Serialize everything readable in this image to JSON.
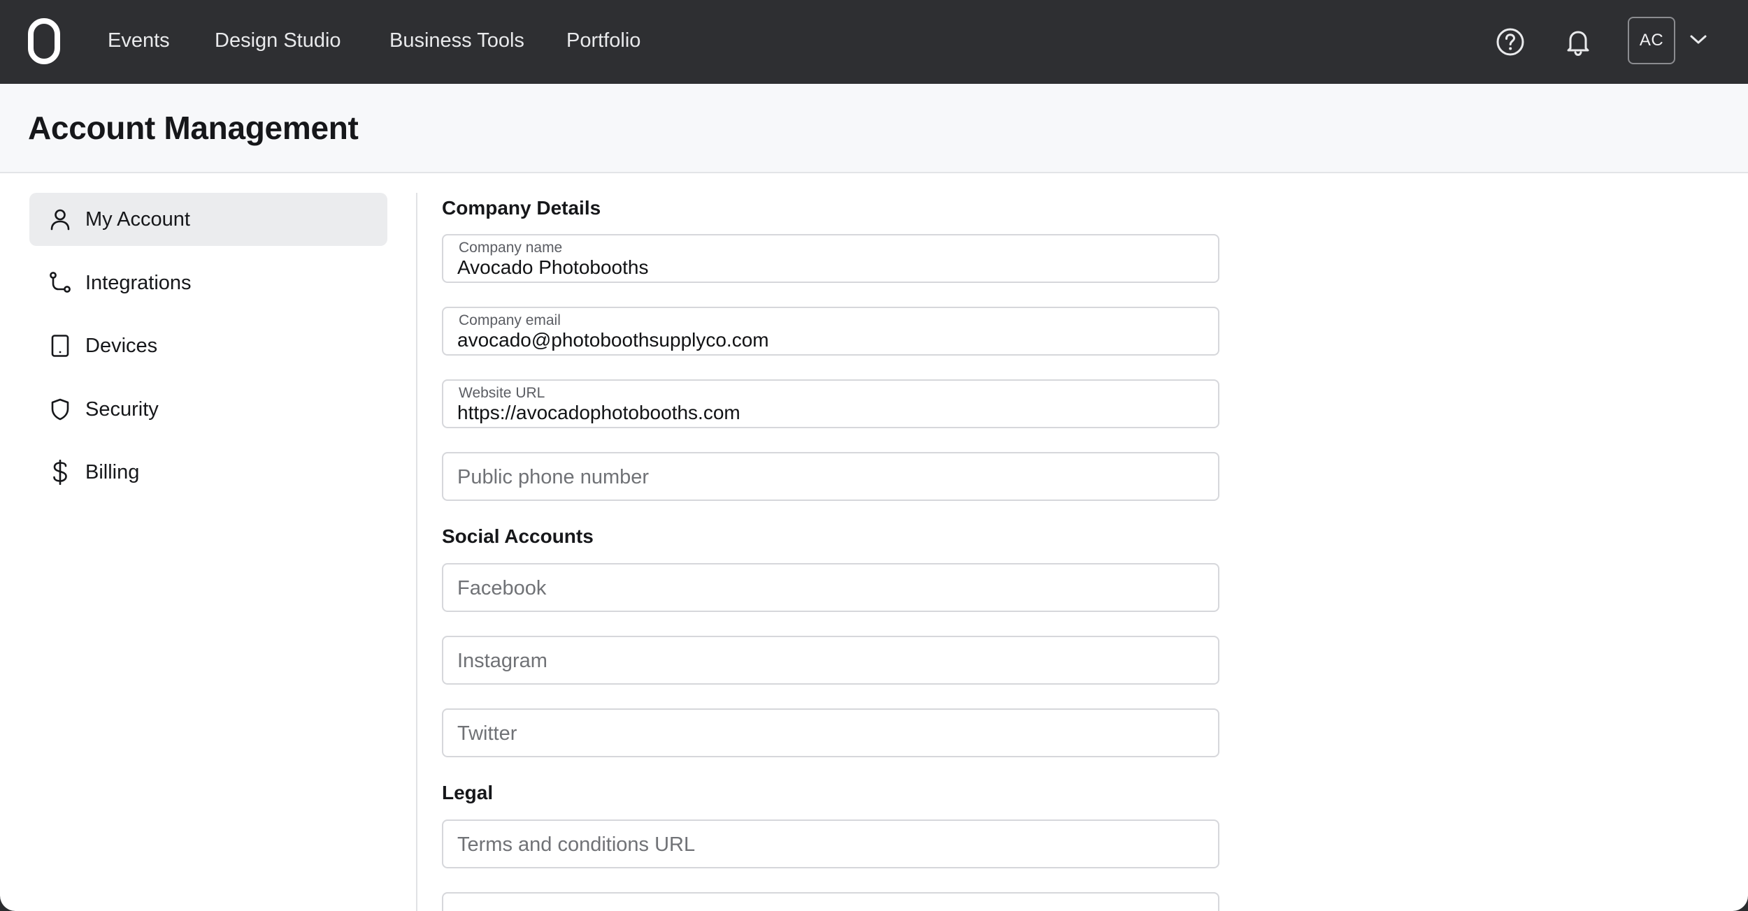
{
  "nav": {
    "items": [
      {
        "label": "Events"
      },
      {
        "label": "Design Studio"
      },
      {
        "label": "Business Tools"
      },
      {
        "label": "Portfolio"
      }
    ],
    "avatar_initials": "AC"
  },
  "icons": {
    "logo": "brand-logo",
    "help": "help-circle-icon",
    "notifications": "bell-icon",
    "account_menu": "chevron-down-icon"
  },
  "header": {
    "title": "Account Management"
  },
  "sidebar": {
    "items": [
      {
        "label": "My Account",
        "icon": "user-icon",
        "active": true
      },
      {
        "label": "Integrations",
        "icon": "integration-icon",
        "active": false
      },
      {
        "label": "Devices",
        "icon": "tablet-icon",
        "active": false
      },
      {
        "label": "Security",
        "icon": "shield-icon",
        "active": false
      },
      {
        "label": "Billing",
        "icon": "dollar-icon",
        "active": false
      }
    ]
  },
  "form": {
    "company": {
      "title": "Company Details",
      "name": {
        "label": "Company name",
        "value": "Avocado Photobooths"
      },
      "email": {
        "label": "Company email",
        "value": "avocado@photoboothsupplyco.com"
      },
      "website": {
        "label": "Website URL",
        "value": "https://avocadophotobooths.com"
      },
      "phone": {
        "placeholder": "Public phone number"
      }
    },
    "social": {
      "title": "Social Accounts",
      "facebook": {
        "placeholder": "Facebook"
      },
      "instagram": {
        "placeholder": "Instagram"
      },
      "twitter": {
        "placeholder": "Twitter"
      }
    },
    "legal": {
      "title": "Legal",
      "terms": {
        "placeholder": "Terms and conditions URL"
      }
    }
  },
  "colors": {
    "nav_bg": "#2e2f32",
    "header_bg": "#f7f8fa",
    "active_item_bg": "#ebecee",
    "field_border": "#d6d7db"
  }
}
